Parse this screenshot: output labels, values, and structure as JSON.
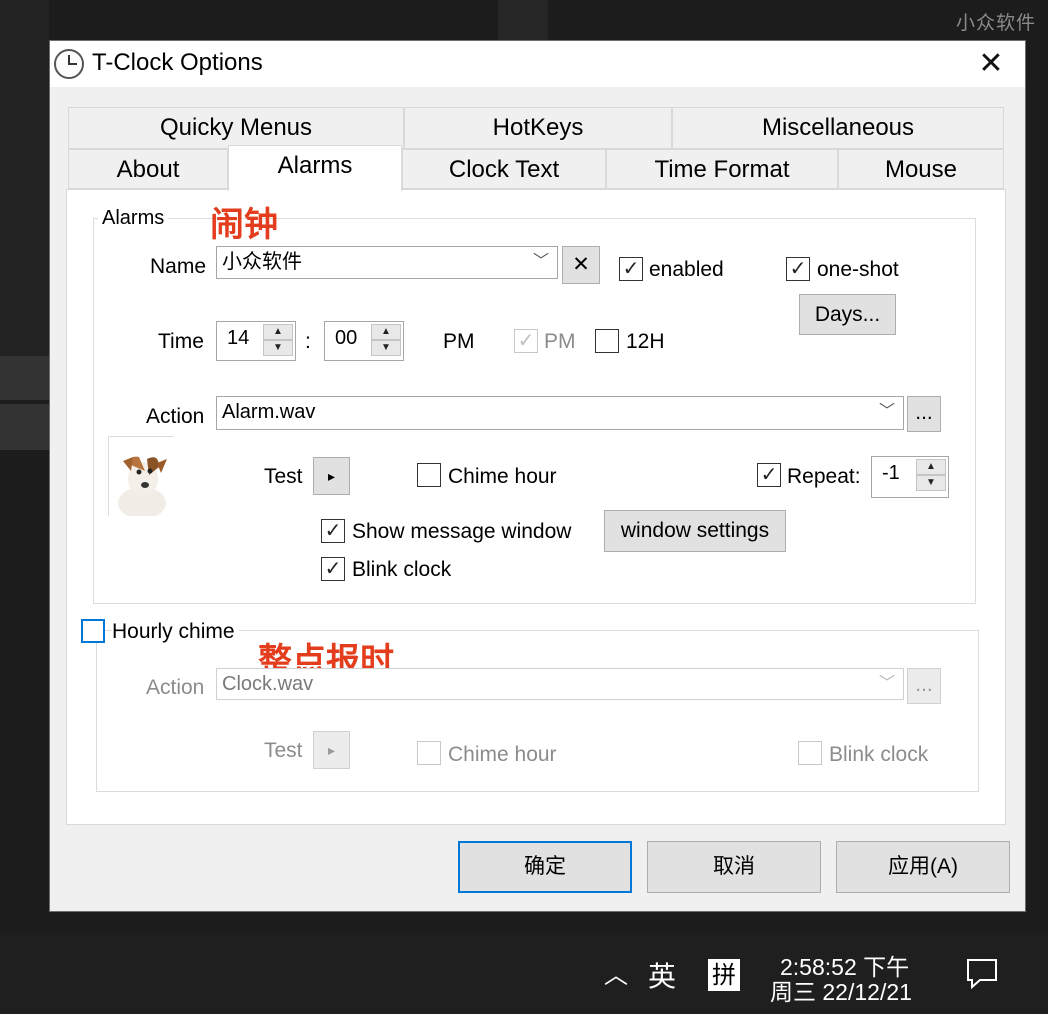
{
  "watermark": "小众软件",
  "window": {
    "title": "T-Clock Options"
  },
  "tabs_row1": [
    "Quicky Menus",
    "HotKeys",
    "Miscellaneous"
  ],
  "tabs_row2": [
    "About",
    "Alarms",
    "Clock Text",
    "Time Format",
    "Mouse"
  ],
  "active_tab": "Alarms",
  "alarms": {
    "group_label": "Alarms",
    "annotation": "闹钟",
    "name_label": "Name",
    "name_value": "小众软件",
    "clear_glyph": "✕",
    "enabled_label": "enabled",
    "enabled_checked": true,
    "oneshot_label": "one-shot",
    "oneshot_checked": true,
    "days_button": "Days...",
    "time_label": "Time",
    "hour": "14",
    "colon": ":",
    "minute": "00",
    "ampm_text": "PM",
    "pm_check_label": "PM",
    "pm_checked": true,
    "h12_label": "12H",
    "h12_checked": false,
    "action_label": "Action",
    "action_value": "Alarm.wav",
    "browse_button": "...",
    "test_label": "Test",
    "play_glyph": "▸",
    "chime_hour_label": "Chime hour",
    "chime_hour_checked": false,
    "repeat_label": "Repeat:",
    "repeat_checked": true,
    "repeat_value": "-1",
    "show_message_label": "Show message window",
    "show_message_checked": true,
    "window_settings_button": "window settings",
    "blink_label": "Blink clock",
    "blink_checked": true
  },
  "hourly": {
    "checkbox_label": "Hourly chime",
    "checked": false,
    "annotation": "整点报时",
    "action_label": "Action",
    "action_value": "Clock.wav",
    "browse_button": "...",
    "test_label": "Test",
    "play_glyph": "▸",
    "chime_hour_label": "Chime hour",
    "blink_label": "Blink clock"
  },
  "buttons": {
    "ok": "确定",
    "cancel": "取消",
    "apply": "应用(A)"
  },
  "taskbar": {
    "chevron": "︿",
    "lang": "英",
    "ime": "拼",
    "time": "2:58:52 下午",
    "date": "周三 22/12/21",
    "notification_icon": "speech-bubble"
  },
  "colors": {
    "annotation": "#e43d1d",
    "accent": "#0078d7"
  }
}
